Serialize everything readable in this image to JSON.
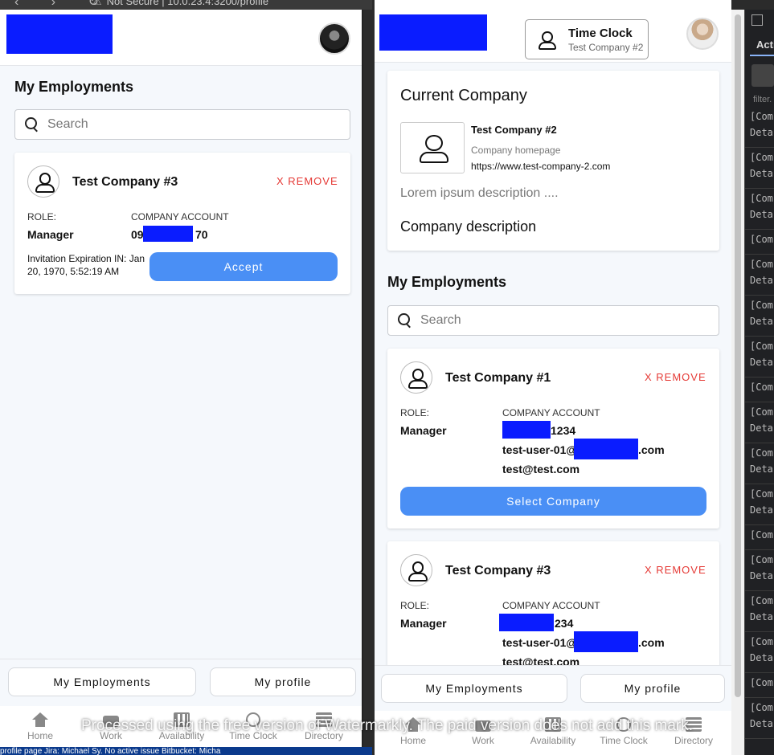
{
  "browser": {
    "url_text": "Not Secure  |  10.0.23.4:3200/profile"
  },
  "left": {
    "section_title": "My Employments",
    "search_placeholder": "Search",
    "card": {
      "company": "Test Company #3",
      "remove": "X REMOVE",
      "role_label": "ROLE:",
      "role_value": "Manager",
      "account_label": "COMPANY ACCOUNT",
      "account_prefix": "09",
      "account_suffix": "70",
      "invitation": "Invitation Expiration IN: Jan 20, 1970, 5:52:19 AM",
      "accept": "Accept"
    },
    "bottom": {
      "my_employments": "My Employments",
      "my_profile": "My profile"
    },
    "tabs": [
      "Home",
      "Work",
      "Availability",
      "Time Clock",
      "Directory"
    ]
  },
  "right": {
    "time_clock": {
      "title": "Time Clock",
      "company": "Test Company #2"
    },
    "current_company": {
      "heading": "Current Company",
      "name": "Test Company #2",
      "homepage_label": "Company homepage",
      "homepage_url": "https://www.test-company-2.com",
      "lorem": "Lorem ipsum description ....",
      "description": "Company description"
    },
    "section_title": "My Employments",
    "search_placeholder": "Search",
    "cards": [
      {
        "company": "Test Company #1",
        "remove": "X REMOVE",
        "role_label": "ROLE:",
        "role_value": "Manager",
        "account_label": "COMPANY ACCOUNT",
        "account_suffix": "1234",
        "email_prefix": "test-user-01@",
        "email_suffix": ".com",
        "email2": "test@test.com",
        "select": "Select Company"
      },
      {
        "company": "Test Company #3",
        "remove": "X REMOVE",
        "role_label": "ROLE:",
        "role_value": "Manager",
        "account_label": "COMPANY ACCOUNT",
        "account_suffix": "234",
        "email_prefix": "test-user-01@",
        "email_suffix": ".com",
        "email2": "test@test.com"
      }
    ],
    "bottom": {
      "my_employments": "My Employments",
      "my_profile": "My profile"
    },
    "tabs": [
      "Home",
      "Work",
      "Availability",
      "Time Clock",
      "Directory"
    ]
  },
  "devtools": {
    "tab": "Acti",
    "filter": "filter.",
    "rows": [
      "[Com",
      "Deta",
      "[Com",
      "Deta",
      "[Com",
      "Deta",
      "[Com",
      "[Com",
      "Deta",
      "[Com",
      "Deta",
      "[Com",
      "Deta",
      "[Com",
      "[Com",
      "Deta",
      "[Com",
      "Deta",
      "[Com",
      "Deta",
      "[Com",
      "[Com",
      "Deta",
      "[Com",
      "Deta",
      "[Com",
      "Deta",
      "[Com",
      "[Com",
      "Deta"
    ]
  },
  "taskbar_text": "profile page     Jira: Michael Sy.     No active issue     Bitbucket: Micha",
  "watermark": "Processed using the free version of Watermarkly. The paid version does not add this mark."
}
